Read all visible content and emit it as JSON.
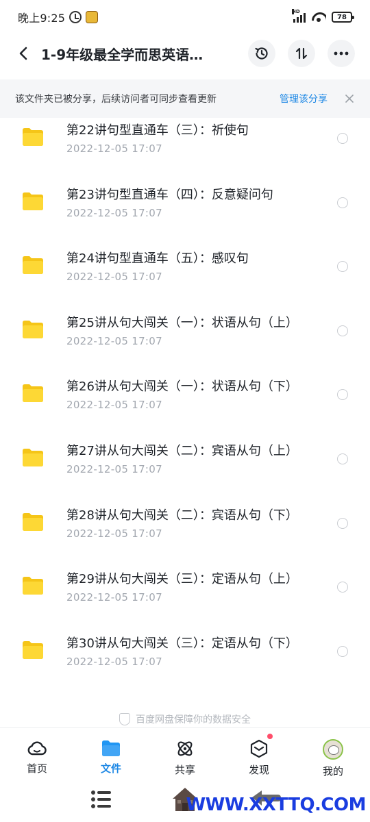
{
  "status_bar": {
    "time": "晚上9:25",
    "network_label": "HD",
    "battery": "78"
  },
  "header": {
    "title": "1-9年级最全学而思英语…"
  },
  "share_banner": {
    "text": "该文件夹已被分享，后续访问者可同步查看更新",
    "manage_label": "管理该分享"
  },
  "files": [
    {
      "name": "第22讲句型直通车（三）：祈使句",
      "date": "2022-12-05   17:07"
    },
    {
      "name": "第23讲句型直通车（四）：反意疑问句",
      "date": "2022-12-05   17:07"
    },
    {
      "name": "第24讲句型直通车（五）：感叹句",
      "date": "2022-12-05   17:07"
    },
    {
      "name": "第25讲从句大闯关（一）：状语从句（上）",
      "date": "2022-12-05   17:07"
    },
    {
      "name": "第26讲从句大闯关（一）：状语从句（下）",
      "date": "2022-12-05   17:07"
    },
    {
      "name": "第27讲从句大闯关（二）：宾语从句（上）",
      "date": "2022-12-05   17:07"
    },
    {
      "name": "第28讲从句大闯关（二）：宾语从句（下）",
      "date": "2022-12-05   17:07"
    },
    {
      "name": "第29讲从句大闯关（三）：定语从句（上）",
      "date": "2022-12-05   17:07"
    },
    {
      "name": "第30讲从句大闯关（三）：定语从句（下）",
      "date": "2022-12-05   17:07"
    }
  ],
  "safety_note": "百度网盘保障你的数据安全",
  "nav": [
    {
      "label": "首页",
      "icon": "cloud-icon"
    },
    {
      "label": "文件",
      "icon": "folder-icon"
    },
    {
      "label": "共享",
      "icon": "atom-icon"
    },
    {
      "label": "发现",
      "icon": "cube-icon"
    },
    {
      "label": "我的",
      "icon": "avatar"
    }
  ],
  "watermark": "WWW.XXTTQ.COM",
  "colors": {
    "accent": "#1e88e5",
    "folder": "#fdd835",
    "date_text": "#a3a8b0",
    "banner_bg": "#f5f6f8",
    "badge_dot": "#ff4d6a",
    "watermark": "#1a3de0"
  }
}
